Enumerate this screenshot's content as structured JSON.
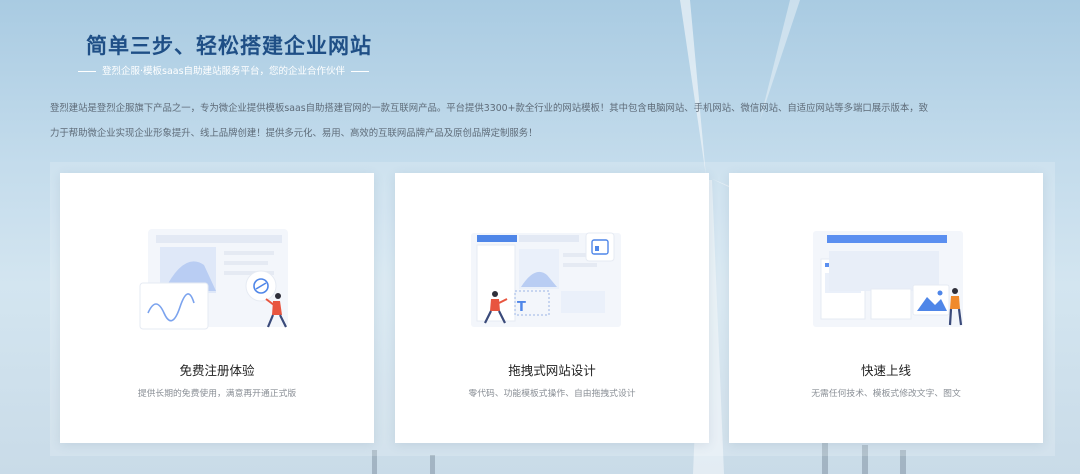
{
  "header": {
    "title": "简单三步、轻松搭建企业网站",
    "subtitle": "登烈企服·模板saas自助建站服务平台，您的企业合作伙伴",
    "description": "登烈建站是登烈企服旗下产品之一，专为微企业提供模板saas自助搭建官网的一款互联网产品。平台提供3300+款全行业的网站模板！其中包含电脑网站、手机网站、微信网站、自适应网站等多端口展示版本，致力于帮助微企业实现企业形象提升、线上品牌创建！提供多元化、易用、高效的互联网品牌产品及原创品牌定制服务！"
  },
  "cards": [
    {
      "title": "免费注册体验",
      "desc": "提供长期的免费使用，满意再开通正式版",
      "illustration": "register-illustration"
    },
    {
      "title": "拖拽式网站设计",
      "desc": "零代码、功能模板式操作、自由拖拽式设计",
      "illustration": "drag-design-illustration"
    },
    {
      "title": "快速上线",
      "desc": "无需任何技术、模板式修改文字、图文",
      "illustration": "launch-illustration"
    }
  ],
  "colors": {
    "title": "#1f4f86",
    "accent": "#3a6fd8",
    "figure": "#e8553f"
  }
}
